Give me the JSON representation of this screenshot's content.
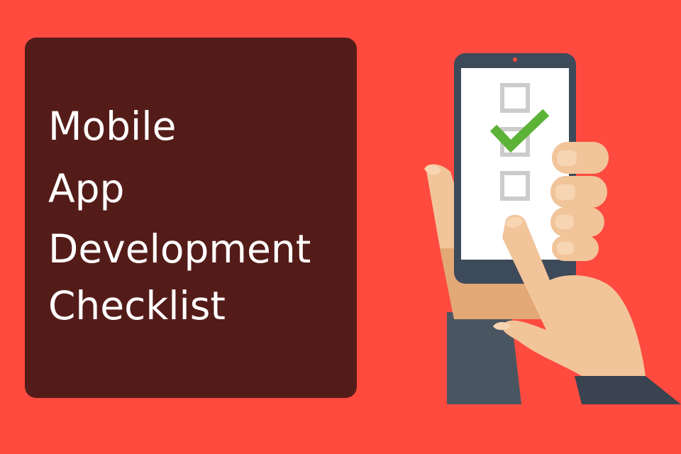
{
  "title_card": {
    "lines": [
      "Mobile",
      "App",
      "Development",
      "Checklist"
    ]
  },
  "illustration": {
    "description_icon": "hand-holding-phone-checklist-icon",
    "checklist_items": [
      {
        "checked": false
      },
      {
        "checked": true
      },
      {
        "checked": false
      }
    ]
  },
  "colors": {
    "background": "#fe4a3f",
    "card": "#541c19",
    "phone_body": "#3d4a5a",
    "screen": "#ffffff",
    "checkbox": "#cccccc",
    "checkmark": "#5cb337",
    "skin": "#f2c49a",
    "skin_shadow": "#e2a875",
    "sleeve": "#4a5562"
  }
}
